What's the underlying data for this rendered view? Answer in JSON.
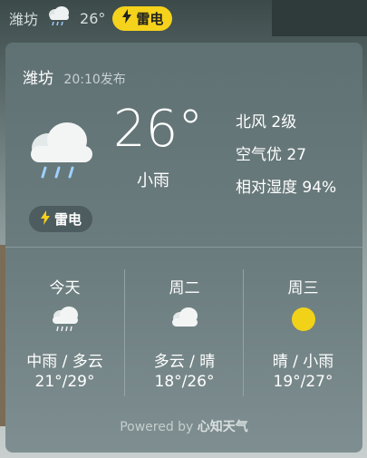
{
  "topbar": {
    "city": "潍坊",
    "temp": "26°",
    "alert_label": "雷电"
  },
  "card": {
    "city": "潍坊",
    "publish_time": "20:10发布",
    "temperature": "26°",
    "condition": "小雨",
    "wind": "北风 2级",
    "air_quality": "空气优 27",
    "humidity": "相对湿度 94%",
    "alert_label": "雷电"
  },
  "forecast": [
    {
      "day": "今天",
      "desc": "中雨 / 多云",
      "range": "21°/29°",
      "icon": "rain-cloud-icon"
    },
    {
      "day": "周二",
      "desc": "多云 / 晴",
      "range": "18°/26°",
      "icon": "cloud-icon"
    },
    {
      "day": "周三",
      "desc": "晴 / 小雨",
      "range": "19°/27°",
      "icon": "sun-icon"
    }
  ],
  "footer": {
    "prefix": "Powered by ",
    "brand": "心知天气"
  },
  "colors": {
    "alert_yellow": "#f5d21b",
    "sun": "#f2d218",
    "rain_drop": "#9fd0ff"
  }
}
